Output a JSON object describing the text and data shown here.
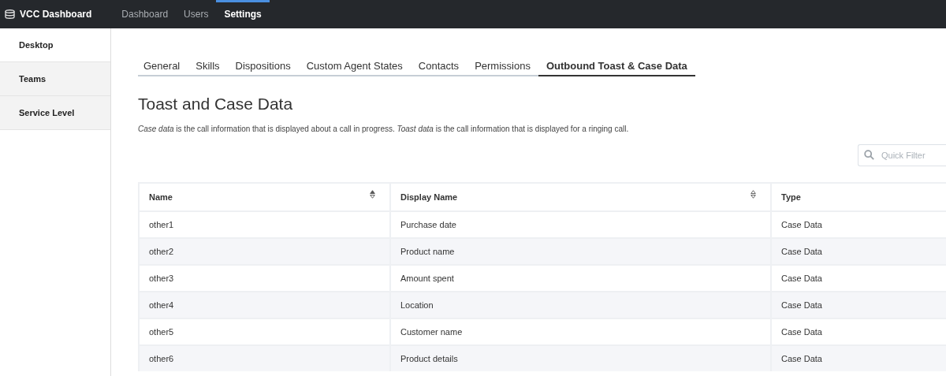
{
  "app": {
    "title": "VCC Dashboard"
  },
  "nav": [
    {
      "label": "Dashboard",
      "selected": false
    },
    {
      "label": "Users",
      "selected": false
    },
    {
      "label": "Settings",
      "selected": true
    }
  ],
  "sidebar": {
    "items": [
      {
        "label": "Desktop",
        "selected": true
      },
      {
        "label": "Teams",
        "selected": false
      },
      {
        "label": "Service Level",
        "selected": false
      }
    ]
  },
  "tabs": [
    {
      "label": "General",
      "selected": false
    },
    {
      "label": "Skills",
      "selected": false
    },
    {
      "label": "Dispositions",
      "selected": false
    },
    {
      "label": "Custom Agent States",
      "selected": false
    },
    {
      "label": "Contacts",
      "selected": false
    },
    {
      "label": "Permissions",
      "selected": false
    },
    {
      "label": "Outbound Toast & Case Data",
      "selected": true
    }
  ],
  "heading": "Toast and Case Data",
  "description": "*Case data* is the call information that is displayed about a call in progress. *Toast data* is the call information that is displayed for a ringing call.",
  "quick_filter": {
    "placeholder": "Quick Filter"
  },
  "table": {
    "columns": [
      {
        "label": "Name",
        "sortable": true,
        "sorted": true
      },
      {
        "label": "Display Name",
        "sortable": true,
        "sorted": false
      },
      {
        "label": "Type",
        "sortable": false
      }
    ],
    "rows": [
      [
        "other1",
        "Purchase date",
        "Case Data"
      ],
      [
        "other2",
        "Product name",
        "Case Data"
      ],
      [
        "other3",
        "Amount spent",
        "Case Data"
      ],
      [
        "other4",
        "Location",
        "Case Data"
      ],
      [
        "other5",
        "Customer name",
        "Case Data"
      ],
      [
        "other6",
        "Product details",
        "Case Data"
      ]
    ]
  }
}
